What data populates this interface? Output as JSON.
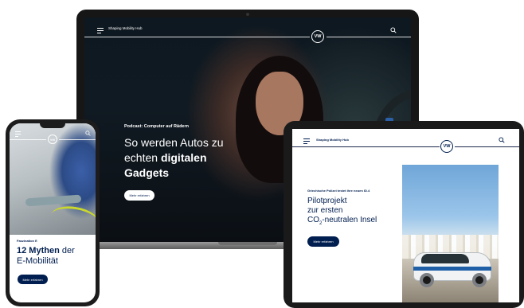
{
  "laptop": {
    "hub_title": "Shaping Mobility Hub",
    "kicker": "Podcast: Computer auf Rädern",
    "headline_line1": "So werden Autos zu",
    "headline_light": "echten",
    "headline_bold": "digitalen",
    "headline_line3": "Gadgets",
    "cta": "Mehr erfahren"
  },
  "phone": {
    "kicker": "Faszination E",
    "headline_bold": "12 Mythen",
    "headline_rest": "der",
    "headline_line2": "E-Mobilität",
    "cta": "Mehr erfahren"
  },
  "tablet": {
    "hub_title": "Shaping Mobility Hub",
    "kicker": "Griechische Polizei testet ihre neuen ID.4",
    "headline_line1": "Pilotprojekt",
    "headline_line2": "zur ersten",
    "headline_co": "CO",
    "headline_sub": "2",
    "headline_rest": "-neutralen Insel",
    "cta": "Mehr erfahren"
  },
  "brand": {
    "logo": "VW",
    "accent": "#001e50"
  },
  "icons": [
    "menu-icon",
    "search-icon",
    "vw-logo-icon"
  ]
}
